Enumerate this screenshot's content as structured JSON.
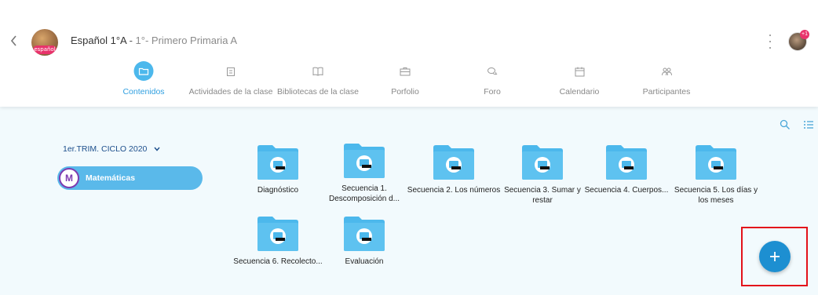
{
  "header": {
    "course_name": "Español 1°A",
    "separator": " - ",
    "group_name": "1°- Primero Primaria A",
    "avatar_badge_text": "español",
    "notification_count": "+1"
  },
  "tabs": [
    {
      "label": "Contenidos",
      "icon": "folder-icon",
      "active": true
    },
    {
      "label": "Actividades de la clase",
      "icon": "activities-icon",
      "active": false
    },
    {
      "label": "Bibliotecas de la clase",
      "icon": "book-icon",
      "active": false
    },
    {
      "label": "Porfolio",
      "icon": "briefcase-icon",
      "active": false
    },
    {
      "label": "Foro",
      "icon": "chat-icon",
      "active": false
    },
    {
      "label": "Calendario",
      "icon": "calendar-icon",
      "active": false
    },
    {
      "label": "Participantes",
      "icon": "people-icon",
      "active": false
    }
  ],
  "sidebar": {
    "term_selector": "1er.TRIM. CICLO 2020",
    "subject": {
      "initial": "M",
      "label": "Matemáticas"
    }
  },
  "folders": [
    {
      "name": "Diagnóstico"
    },
    {
      "name": "Secuencia 1. Descomposición d..."
    },
    {
      "name": "Secuencia 2. Los números"
    },
    {
      "name": "Secuencia 3. Sumar y restar"
    },
    {
      "name": "Secuencia 4. Cuerpos..."
    },
    {
      "name": "Secuencia 5. Los días y los meses"
    },
    {
      "name": "Secuencia 6. Recolecto..."
    },
    {
      "name": "Evaluación"
    }
  ],
  "colors": {
    "accent": "#2f9fe0",
    "folder": "#4cb8ec",
    "fab": "#1d8fd1",
    "highlight": "#e3121a",
    "content_bg": "#f2fafd"
  }
}
